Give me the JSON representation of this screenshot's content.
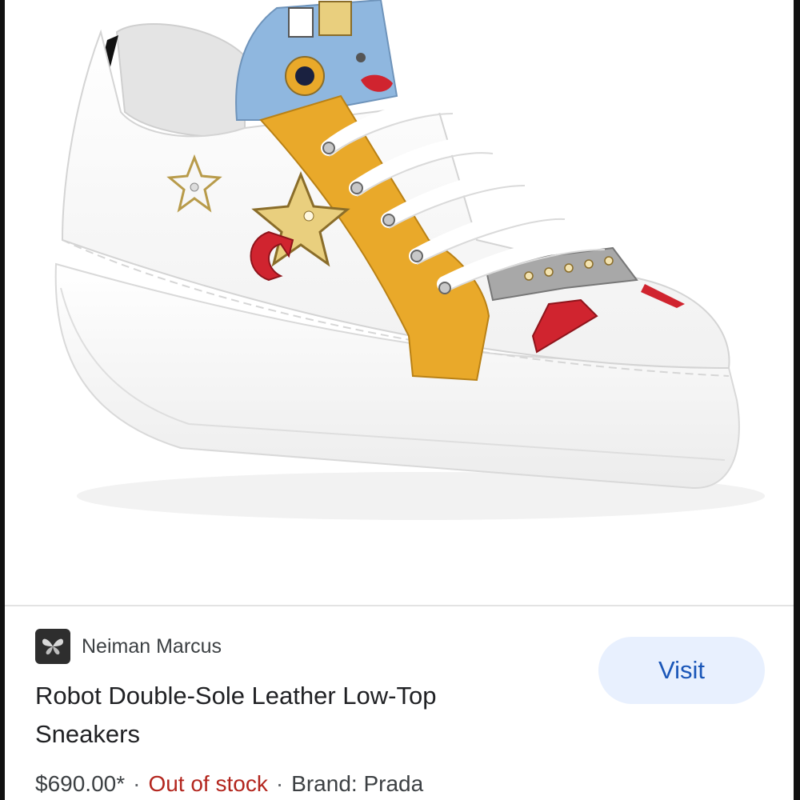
{
  "source": {
    "name": "Neiman Marcus",
    "favicon_icon": "butterfly-icon"
  },
  "product": {
    "title": "Robot Double-Sole Leather Low-Top Sneakers",
    "price": "$690.00*",
    "separator": "·",
    "availability": "Out of stock",
    "brand": "Brand: Prada",
    "image_description_icon": "sneaker-product-image"
  },
  "actions": {
    "visit_label": "Visit"
  },
  "colors": {
    "shoe_white": "#ffffff",
    "mustard": "#e9a92a",
    "sky_blue": "#8fb7df",
    "red_accent": "#d0242f",
    "gold_star": "#e9cf7e",
    "availability_red": "#b3261e",
    "visit_bg": "#e8f0fe",
    "visit_text": "#1a56b8"
  }
}
